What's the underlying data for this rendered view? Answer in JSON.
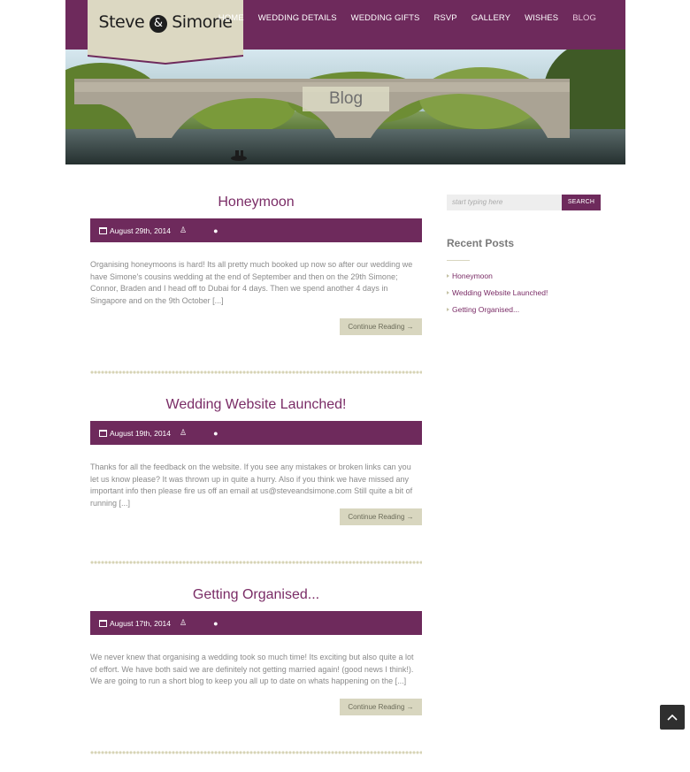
{
  "site": {
    "logo_part1": "Steve",
    "logo_amp": "&",
    "logo_part2": "Simone"
  },
  "nav": {
    "items": [
      {
        "label": "HOME"
      },
      {
        "label": "WEDDING DETAILS"
      },
      {
        "label": "WEDDING GIFTS"
      },
      {
        "label": "RSVP"
      },
      {
        "label": "GALLERY"
      },
      {
        "label": "WISHES"
      },
      {
        "label": "BLOG",
        "active": true
      }
    ]
  },
  "hero": {
    "title": "Blog"
  },
  "posts": [
    {
      "title": "Honeymoon",
      "date": "August 29th, 2014",
      "excerpt": "Organising honeymoons is hard! Its all pretty much booked up now so after our wedding we have Simone's cousins wedding at the end of September and then on the 29th Simone; Connor, Braden and I head off to Dubai for 4 days. Then we spend another 4 days in Singapore and on the 9th October [...]",
      "continue_label": "Continue Reading →"
    },
    {
      "title": "Wedding Website Launched!",
      "date": "August 19th, 2014",
      "excerpt": "Thanks for all the feedback on the website. If you see any mistakes or broken links can you let us know please? It was thrown up in quite a hurry. Also if you think we have missed any important info then please fire us off an email at us@steveandsimone.com Still quite a bit of running [...]",
      "continue_label": "Continue Reading →"
    },
    {
      "title": "Getting Organised...",
      "date": "August 17th, 2014",
      "excerpt": "We never knew that organising a wedding took so much time! Its exciting but also quite a lot of effort. We have both said we are definitely not getting married again! (good news I think!). We are going to run a short blog to keep you all up to date on whats happening on the [...]",
      "continue_label": "Continue Reading →"
    }
  ],
  "sidebar": {
    "search_placeholder": "start typing here",
    "search_button": "SEARCH",
    "recent_title": "Recent Posts",
    "recent_posts": [
      {
        "label": "Honeymoon"
      },
      {
        "label": "Wedding Website Launched!"
      },
      {
        "label": "Getting Organised..."
      }
    ]
  },
  "colors": {
    "brand": "#6e2a5c",
    "accent_beige": "#d8d6bf"
  },
  "icons": {
    "calendar": "calendar-icon",
    "user": "user-icon",
    "comment": "comment-icon",
    "back_to_top": "chevron-up-icon"
  }
}
